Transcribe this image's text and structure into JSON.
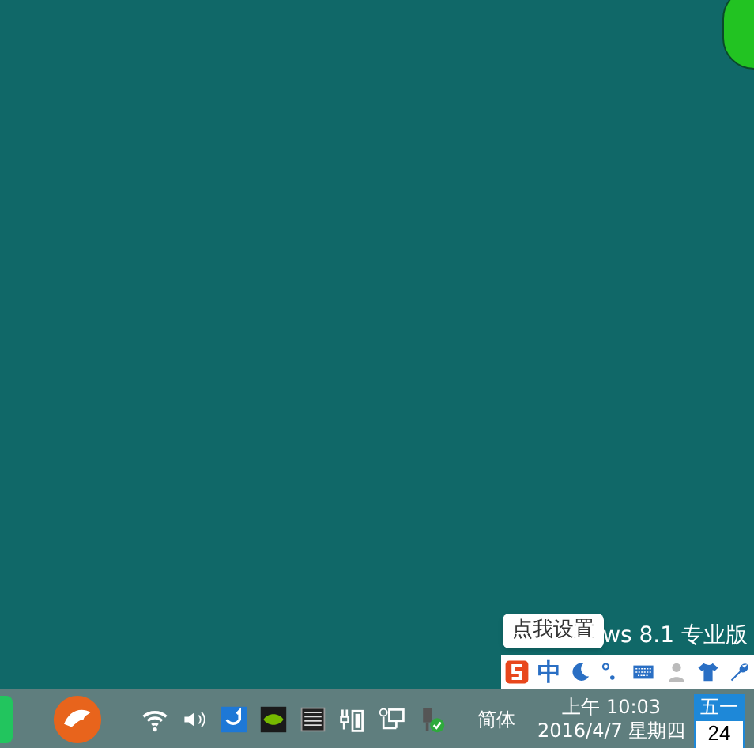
{
  "desktop": {
    "watermark": "ws 8.1 专业版"
  },
  "ime_tooltip": {
    "text": "点我设置"
  },
  "ime_toolbar": {
    "mode": "中"
  },
  "taskbar": {
    "language": "简体",
    "clock": {
      "time": "上午 10:03",
      "date": "2016/4/7 星期四"
    },
    "calendar": {
      "weekday": "五一",
      "day": "24"
    }
  }
}
